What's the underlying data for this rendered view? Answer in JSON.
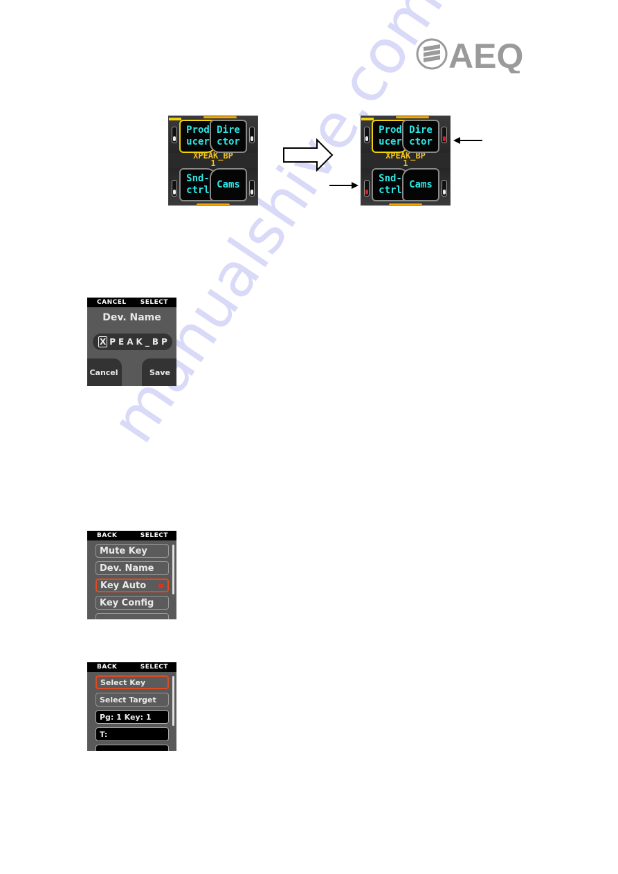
{
  "brand": {
    "logo_text": "AEQ",
    "logo_color": "#9a9a9a"
  },
  "watermark": "manualshive.com",
  "key_panels": [
    {
      "id": "before",
      "device_name": "XPEAK_BP",
      "page": "1",
      "keys": [
        {
          "label": "Prod\nucer",
          "active": true,
          "led": "off"
        },
        {
          "label": "Dire\nctor",
          "active": false,
          "led": "off"
        },
        {
          "label": "Snd-\nctrl",
          "active": false,
          "led": "off"
        },
        {
          "label": "Cams",
          "active": false,
          "led": "off"
        }
      ]
    },
    {
      "id": "after",
      "device_name": "XPEAK_BP",
      "page": "1",
      "keys": [
        {
          "label": "Prod\nucer",
          "active": true,
          "led": "off"
        },
        {
          "label": "Dire\nctor",
          "active": false,
          "led": "red"
        },
        {
          "label": "Snd-\nctrl",
          "active": false,
          "led": "red"
        },
        {
          "label": "Cams",
          "active": false,
          "led": "off"
        }
      ]
    }
  ],
  "colors": {
    "key_text": "#2ee6e6",
    "device_name": "#f2c020",
    "active_key_border": "#f2d20a",
    "led_red": "#e02020",
    "led_off": "#eeeeee",
    "selection_border": "#e04a20"
  },
  "dev_name_screen": {
    "softkey_left": "CANCEL",
    "softkey_right": "SELECT",
    "title": "Dev. Name",
    "cursor_char": "X",
    "name_rest": "PEAK_BP",
    "cancel_button": "Cancel",
    "save_button": "Save"
  },
  "settings_menu_screen": {
    "softkey_left": "BACK",
    "softkey_right": "SELECT",
    "items": [
      {
        "label": "Mute Key",
        "selected": false
      },
      {
        "label": "Dev. Name",
        "selected": false
      },
      {
        "label": "Key Auto",
        "selected": true,
        "indicator": "red"
      },
      {
        "label": "Key Config",
        "selected": false
      }
    ]
  },
  "key_auto_screen": {
    "softkey_left": "BACK",
    "softkey_right": "SELECT",
    "items": [
      {
        "label": "Select Key",
        "selected": true
      },
      {
        "label": "Select Target",
        "selected": false
      },
      {
        "label": "Pg: 1 Key: 1",
        "type": "value"
      },
      {
        "label": "T:",
        "type": "value"
      }
    ]
  }
}
